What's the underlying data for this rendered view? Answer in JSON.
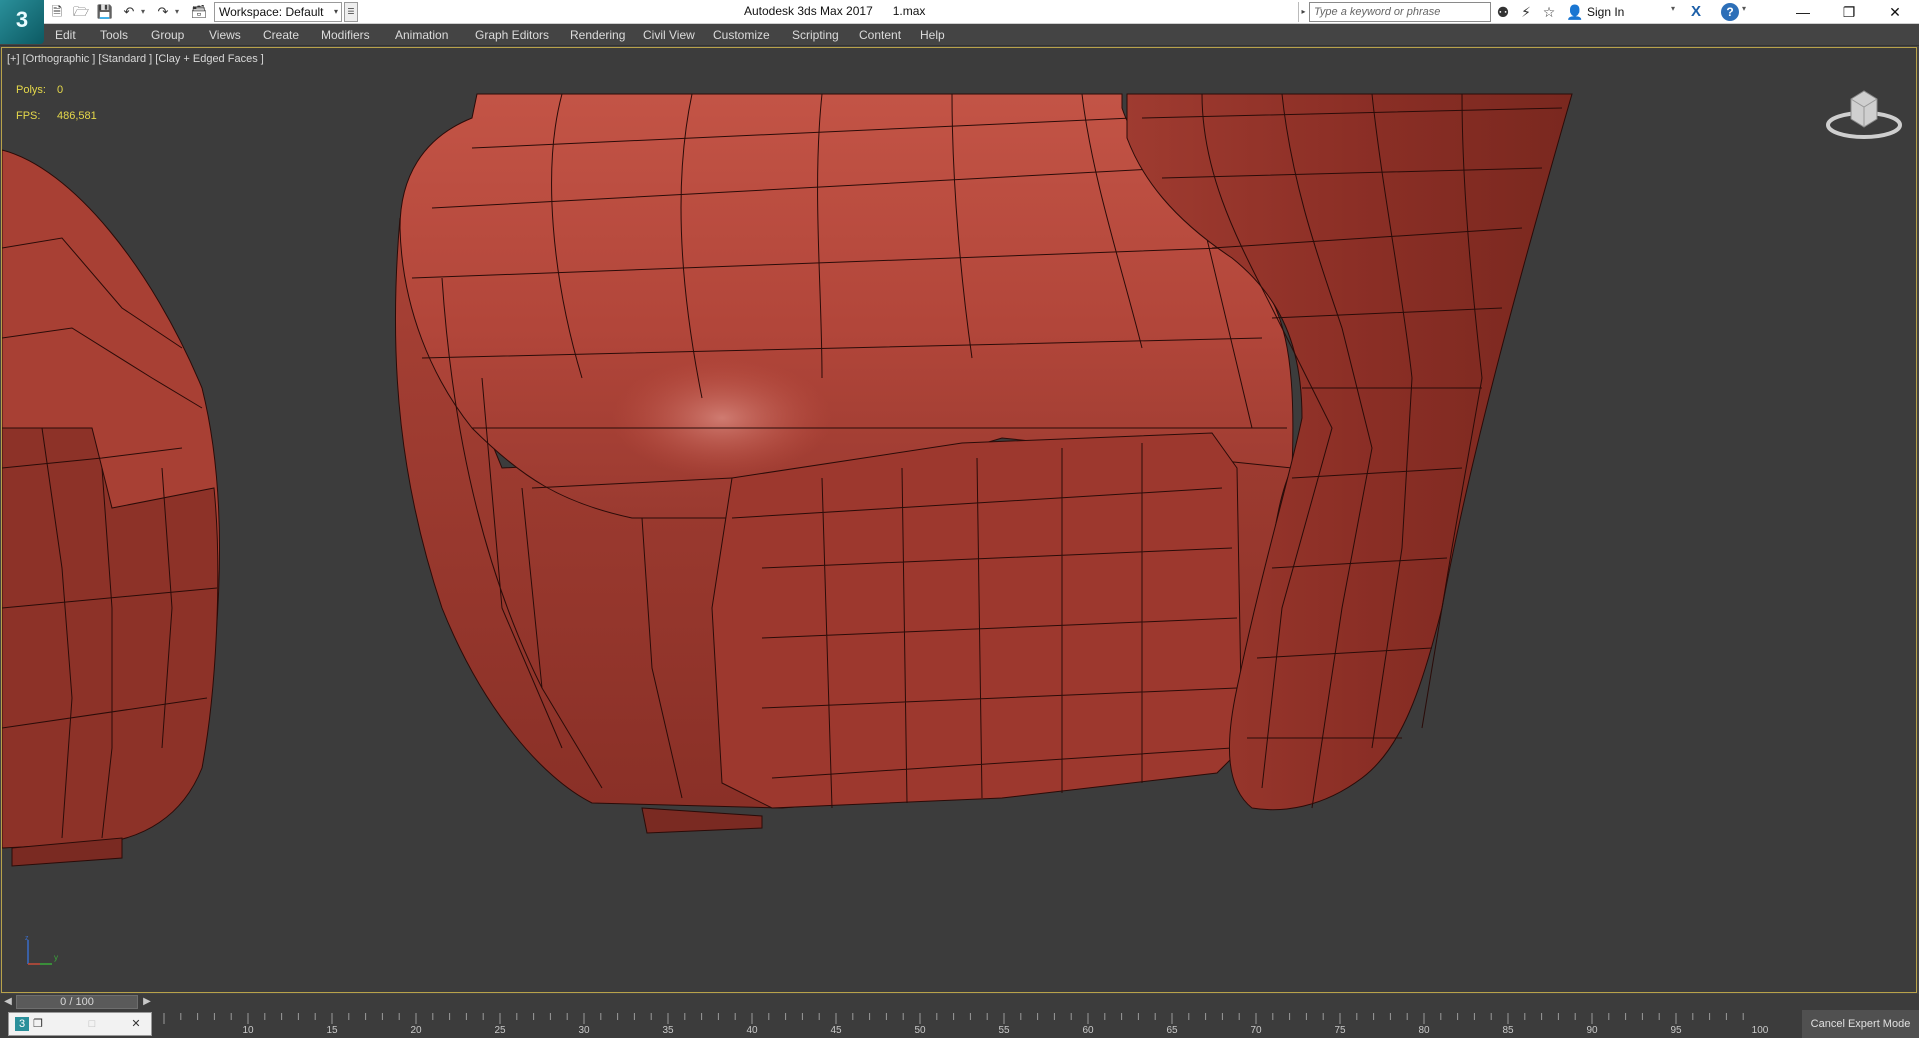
{
  "app": {
    "logo_text": "3",
    "window_title": "Autodesk 3ds Max 2017      1.max"
  },
  "quick_access": {
    "workspace_label": "Workspace: Default"
  },
  "infocenter": {
    "search_placeholder": "Type a keyword or phrase",
    "sign_in_label": "Sign In",
    "help_label": "?"
  },
  "menu": {
    "items": [
      "Edit",
      "Tools",
      "Group",
      "Views",
      "Create",
      "Modifiers",
      "Animation",
      "Graph Editors",
      "Rendering",
      "Civil View",
      "Customize",
      "Scripting",
      "Content",
      "Help"
    ]
  },
  "viewport": {
    "label": "[+] [Orthographic ] [Standard ] [Clay + Edged Faces ]",
    "stats": {
      "polys_label": "Polys:",
      "polys_value": "0",
      "fps_label": "FPS:",
      "fps_value": "486,581"
    },
    "mesh_color": "#b8473a",
    "background_color": "#3c3c3c"
  },
  "timeline": {
    "slider_text": "0 / 100",
    "ticks": [
      "10",
      "15",
      "20",
      "25",
      "30",
      "35",
      "40",
      "45",
      "50",
      "55",
      "60",
      "65",
      "70",
      "75",
      "80",
      "85",
      "90",
      "95",
      "100"
    ]
  },
  "status": {
    "expert_mode_label": "Cancel Expert Mode"
  },
  "icons": {
    "titlebar": [
      "new-file-icon",
      "open-file-icon",
      "save-icon",
      "undo-icon",
      "redo-icon",
      "project-folder-icon",
      "binoculars-icon",
      "communication-center-icon",
      "favorites-star-icon",
      "user-icon",
      "autodesk-exchange-icon",
      "help-icon"
    ]
  }
}
